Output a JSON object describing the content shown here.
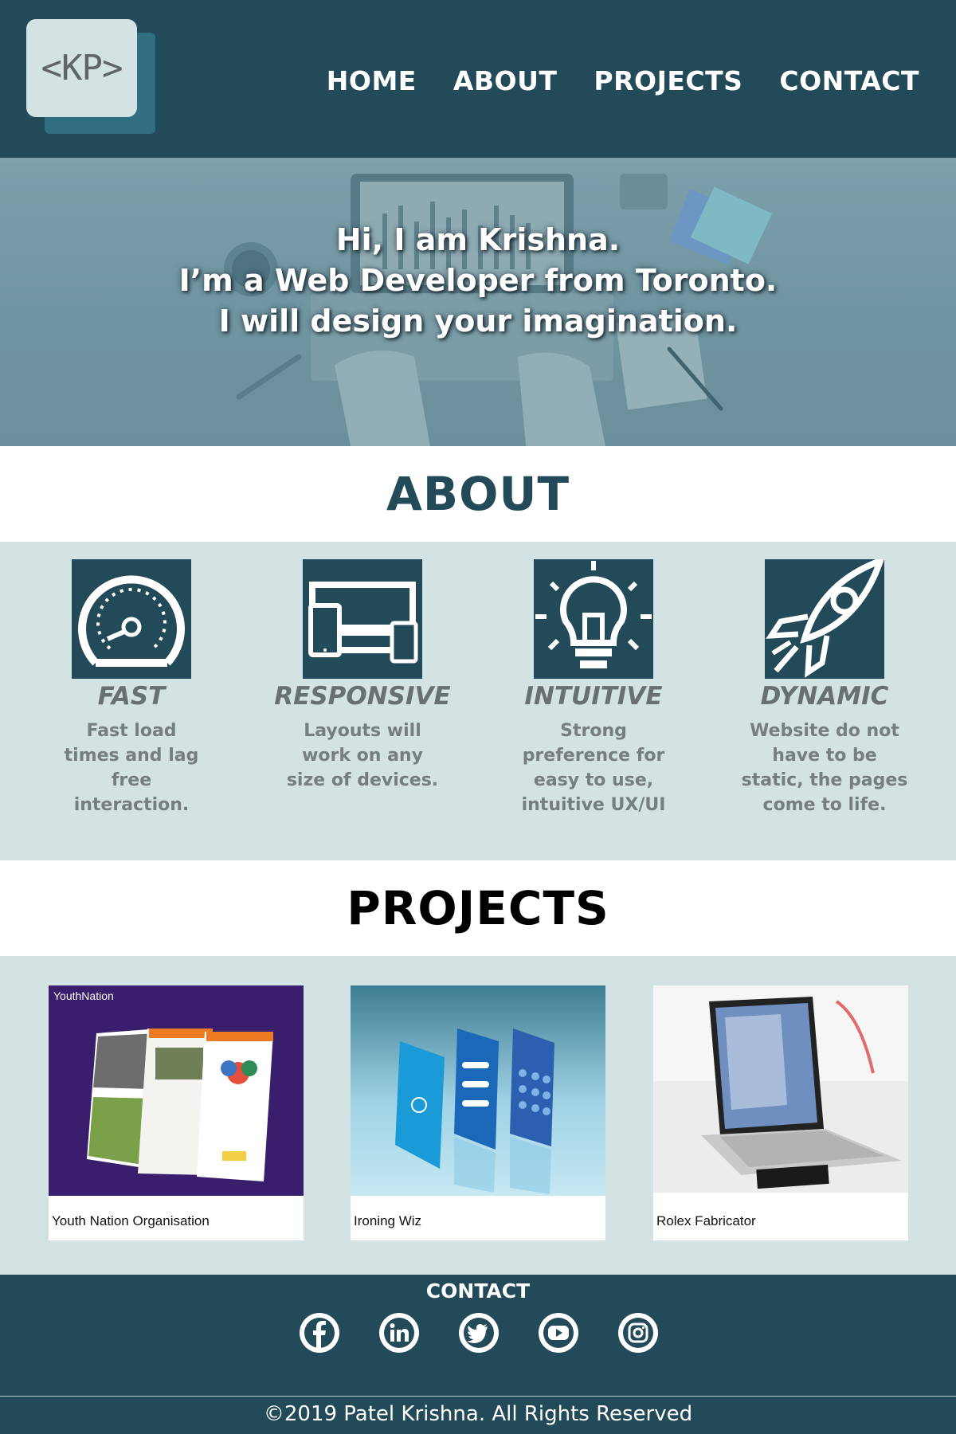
{
  "header": {
    "logo_text": "<KP>",
    "nav": [
      "HOME",
      "ABOUT",
      "PROJECTS",
      "CONTACT"
    ]
  },
  "hero": {
    "lines": [
      "Hi, I am Krishna.",
      "I’m a Web Developer from Toronto.",
      "I will design your imagination."
    ]
  },
  "about": {
    "title": "ABOUT",
    "features": [
      {
        "icon": "speedometer-icon",
        "title": "FAST",
        "desc": "Fast load times and lag free interaction."
      },
      {
        "icon": "devices-icon",
        "title": "RESPONSIVE",
        "desc": "Layouts will work on any size of devices."
      },
      {
        "icon": "lightbulb-icon",
        "title": "INTUITIVE",
        "desc": "Strong preference for easy to use, intuitive UX/UI"
      },
      {
        "icon": "rocket-icon",
        "title": "DYNAMIC",
        "desc": "Website do not have to be static, the pages come to life."
      }
    ]
  },
  "projects": {
    "title": "PROJECTS",
    "cards": [
      {
        "caption": "Youth Nation Organisation",
        "thumb_label": "YouthNation"
      },
      {
        "caption": "Ironing Wiz"
      },
      {
        "caption": "Rolex Fabricator"
      }
    ]
  },
  "footer": {
    "contact_title": "CONTACT",
    "socials": [
      "facebook-icon",
      "linkedin-icon",
      "twitter-icon",
      "youtube-icon",
      "instagram-icon"
    ],
    "copyright": "©2019 Patel Krishna. All Rights Reserved"
  },
  "colors": {
    "primary": "#224a58",
    "band": "#d3e2e2",
    "text_muted": "#777e80"
  }
}
